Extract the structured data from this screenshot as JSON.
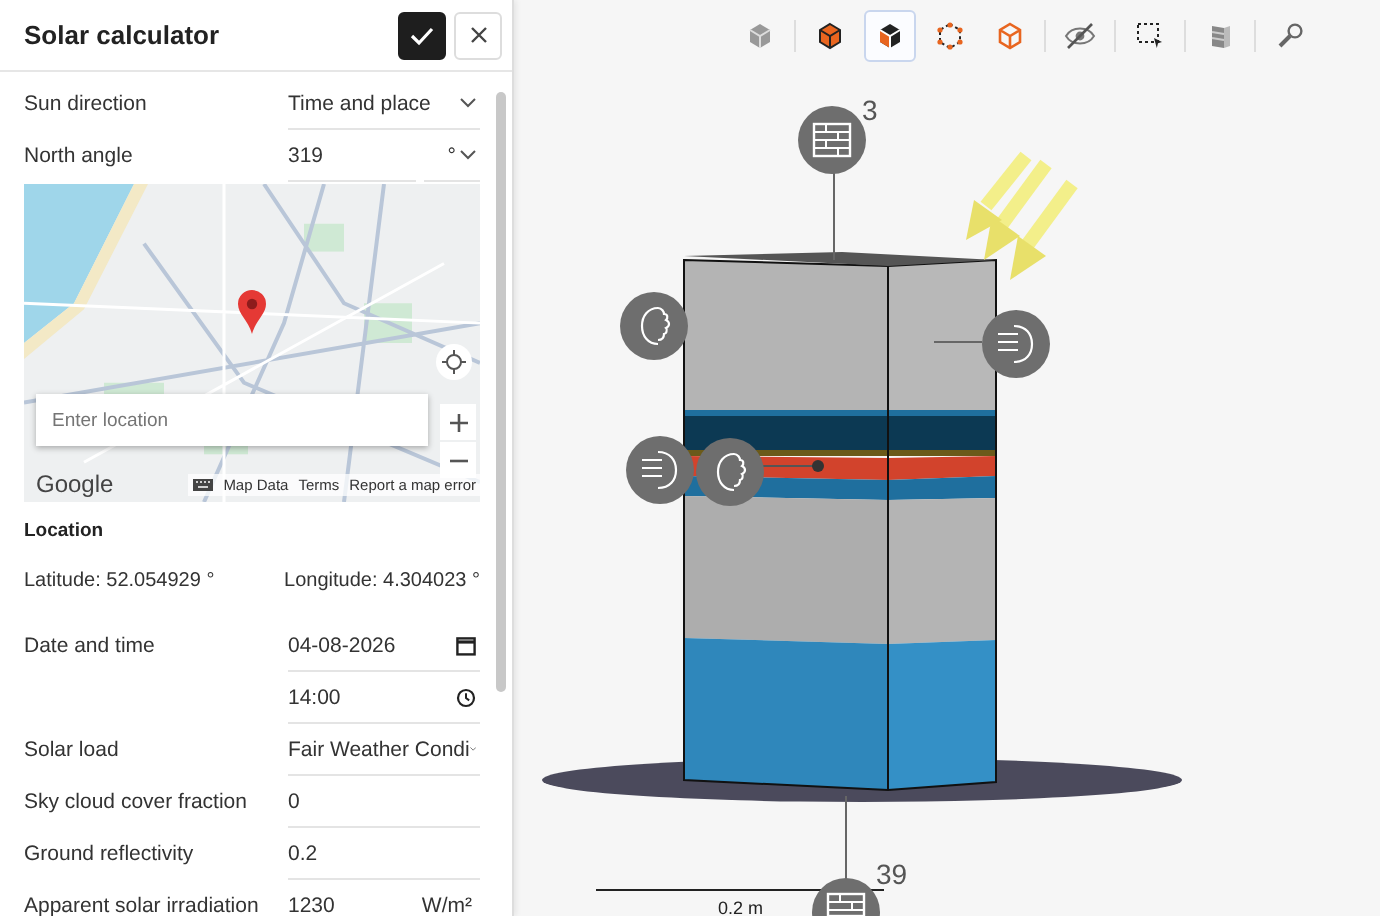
{
  "panel": {
    "title": "Solar calculator"
  },
  "fields_top": [
    {
      "label": "Sun direction",
      "value": "Time and place",
      "kind": "select"
    },
    {
      "label": "North angle",
      "value": "319",
      "unit": "°",
      "kind": "unit-select"
    }
  ],
  "map": {
    "search_placeholder": "Enter location",
    "logo": "Google",
    "links": [
      "Map Data",
      "Terms",
      "Report a map error"
    ]
  },
  "location": {
    "heading": "Location",
    "latitude": "Latitude: 52.054929 °",
    "longitude": "Longitude: 4.304023 °"
  },
  "fields": [
    {
      "label": "Date and time",
      "value": "04-08-2026",
      "kind": "date"
    },
    {
      "value": "14:00",
      "kind": "time"
    },
    {
      "label": "Solar load",
      "value": "Fair Weather Condi",
      "kind": "select"
    },
    {
      "label": "Sky cloud cover fraction",
      "value": "0",
      "kind": "text"
    },
    {
      "label": "Ground reflectivity",
      "value": "0.2",
      "kind": "text"
    },
    {
      "label": "Apparent solar irradiation",
      "value": "1230",
      "unit": "W/m²",
      "kind": "unit-select"
    }
  ],
  "toolbar": [
    {
      "kind": "cube-solid",
      "selected": false
    },
    {
      "kind": "cube-orange",
      "selected": false
    },
    {
      "kind": "cube-half",
      "selected": true
    },
    {
      "kind": "cube-points",
      "selected": false
    },
    {
      "kind": "cube-outline",
      "selected": false
    },
    {
      "kind": "eye-off",
      "selected": false
    },
    {
      "kind": "box-select",
      "selected": false
    },
    {
      "kind": "layers",
      "selected": false
    },
    {
      "kind": "probe",
      "selected": false
    }
  ],
  "viewport": {
    "top_count": "3",
    "bottom_count": "39",
    "scale": "0.2 m"
  }
}
